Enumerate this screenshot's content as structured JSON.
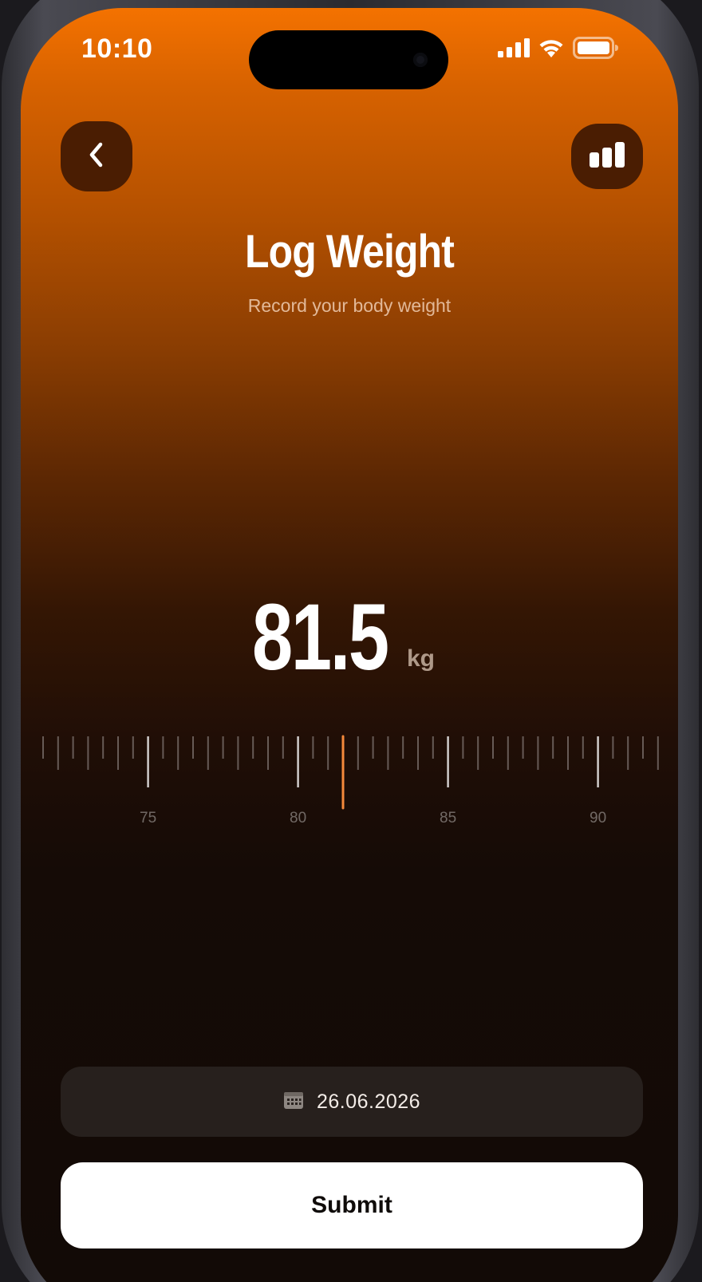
{
  "status_bar": {
    "time": "10:10",
    "icons": [
      "cellular-signal-icon",
      "wifi-icon",
      "battery-icon"
    ]
  },
  "header": {
    "back_icon": "chevron-left-icon",
    "stats_icon": "bar-chart-icon",
    "title": "Log Weight",
    "subtitle": "Record your body weight"
  },
  "weight": {
    "value": "81.5",
    "unit": "kg"
  },
  "ruler": {
    "selected_value": 81.5,
    "min_visible": 71,
    "max_visible": 92,
    "step": 0.5,
    "labels": [
      "75",
      "80",
      "85",
      "90"
    ],
    "accent_color": "#f5893b"
  },
  "date": {
    "icon": "calendar-icon",
    "value": "26.06.2026"
  },
  "submit": {
    "label": "Submit"
  },
  "colors": {
    "gradient_top": "#f47200",
    "background_bottom": "#120a06",
    "button_bg": "#4a1d02",
    "accent": "#f5893b"
  }
}
